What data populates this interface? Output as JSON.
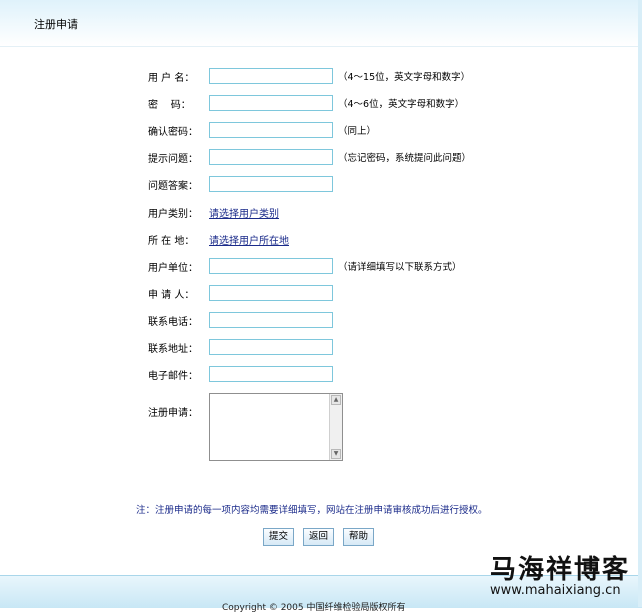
{
  "header": {
    "title": "注册申请"
  },
  "form": {
    "username": {
      "label": "用 户 名：",
      "hint": "（4～15位，英文字母和数字）",
      "value": ""
    },
    "password": {
      "label": "密    码：",
      "hint": "（4～6位，英文字母和数字）",
      "value": ""
    },
    "confirm_password": {
      "label": "确认密码：",
      "hint": "（同上）",
      "value": ""
    },
    "question": {
      "label": "提示问题：",
      "hint": "（忘记密码，系统提问此问题）",
      "value": ""
    },
    "answer": {
      "label": "问题答案：",
      "value": ""
    },
    "user_type": {
      "label": "用户类别：",
      "link": "请选择用户类别"
    },
    "location": {
      "label": "所 在 地：",
      "link": "请选择用户所在地"
    },
    "organization": {
      "label": "用户单位：",
      "hint": "（请详细填写以下联系方式）",
      "value": ""
    },
    "applicant": {
      "label": "申 请 人：",
      "value": ""
    },
    "phone": {
      "label": "联系电话：",
      "value": ""
    },
    "address": {
      "label": "联系地址：",
      "value": ""
    },
    "email": {
      "label": "电子邮件：",
      "value": ""
    },
    "application": {
      "label": "注册申请：",
      "value": ""
    }
  },
  "notice": "注：注册申请的每一项内容均需要详细填写，网站在注册申请审核成功后进行授权。",
  "buttons": {
    "submit": "提交",
    "back": "返回",
    "help": "帮助"
  },
  "footer": {
    "copyright": "Copyright © 2005 中国纤维检验局版权所有"
  },
  "watermark": {
    "title": "马海祥博客",
    "url": "www.mahaixiang.cn"
  }
}
